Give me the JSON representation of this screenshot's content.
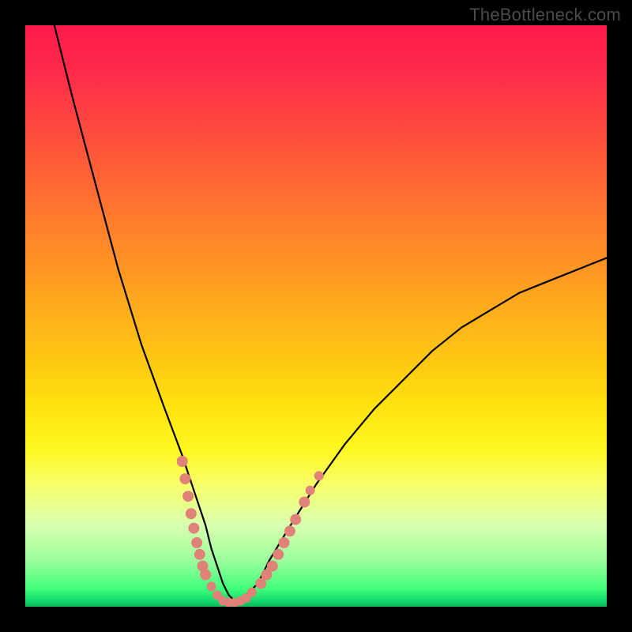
{
  "watermark": "TheBottleneck.com",
  "chart_data": {
    "type": "line",
    "title": "",
    "xlabel": "",
    "ylabel": "",
    "xlim": [
      0,
      100
    ],
    "ylim": [
      0,
      100
    ],
    "grid": false,
    "series": [
      {
        "name": "bottleneck-curve",
        "x": [
          5,
          8,
          12,
          16,
          20,
          24,
          27,
          29,
          31,
          32,
          33,
          34,
          35,
          36,
          37,
          38,
          40,
          42,
          45,
          50,
          55,
          60,
          65,
          70,
          75,
          80,
          85,
          90,
          95,
          100
        ],
        "y": [
          100,
          88,
          73,
          58,
          45,
          34,
          26,
          20,
          14,
          10,
          7,
          4,
          2,
          1,
          1,
          2,
          4,
          8,
          13,
          21,
          28,
          34,
          39,
          44,
          48,
          51,
          54,
          56,
          58,
          60
        ]
      }
    ],
    "markers": {
      "name": "highlight-points",
      "color": "#e08278",
      "points": [
        {
          "x": 27,
          "y": 25,
          "r": 7
        },
        {
          "x": 27.5,
          "y": 22,
          "r": 7
        },
        {
          "x": 28,
          "y": 19,
          "r": 7
        },
        {
          "x": 28.5,
          "y": 16,
          "r": 7
        },
        {
          "x": 29,
          "y": 13.5,
          "r": 7
        },
        {
          "x": 29.5,
          "y": 11,
          "r": 7
        },
        {
          "x": 30,
          "y": 9,
          "r": 7
        },
        {
          "x": 30.5,
          "y": 7,
          "r": 7
        },
        {
          "x": 31,
          "y": 5.5,
          "r": 7
        },
        {
          "x": 32,
          "y": 3.5,
          "r": 6
        },
        {
          "x": 33,
          "y": 2,
          "r": 6
        },
        {
          "x": 34,
          "y": 1,
          "r": 6
        },
        {
          "x": 35,
          "y": 0.7,
          "r": 6
        },
        {
          "x": 36,
          "y": 0.7,
          "r": 6
        },
        {
          "x": 37,
          "y": 1,
          "r": 6
        },
        {
          "x": 38,
          "y": 1.5,
          "r": 6
        },
        {
          "x": 39,
          "y": 2.5,
          "r": 6
        },
        {
          "x": 40.5,
          "y": 4,
          "r": 7
        },
        {
          "x": 41.5,
          "y": 5.5,
          "r": 7
        },
        {
          "x": 42.5,
          "y": 7,
          "r": 7
        },
        {
          "x": 43.5,
          "y": 9,
          "r": 7
        },
        {
          "x": 44.5,
          "y": 11,
          "r": 7
        },
        {
          "x": 45.5,
          "y": 13,
          "r": 7
        },
        {
          "x": 46.5,
          "y": 15,
          "r": 7
        },
        {
          "x": 48,
          "y": 18,
          "r": 7
        },
        {
          "x": 49,
          "y": 20,
          "r": 6
        },
        {
          "x": 50.5,
          "y": 22.5,
          "r": 6
        }
      ]
    }
  }
}
